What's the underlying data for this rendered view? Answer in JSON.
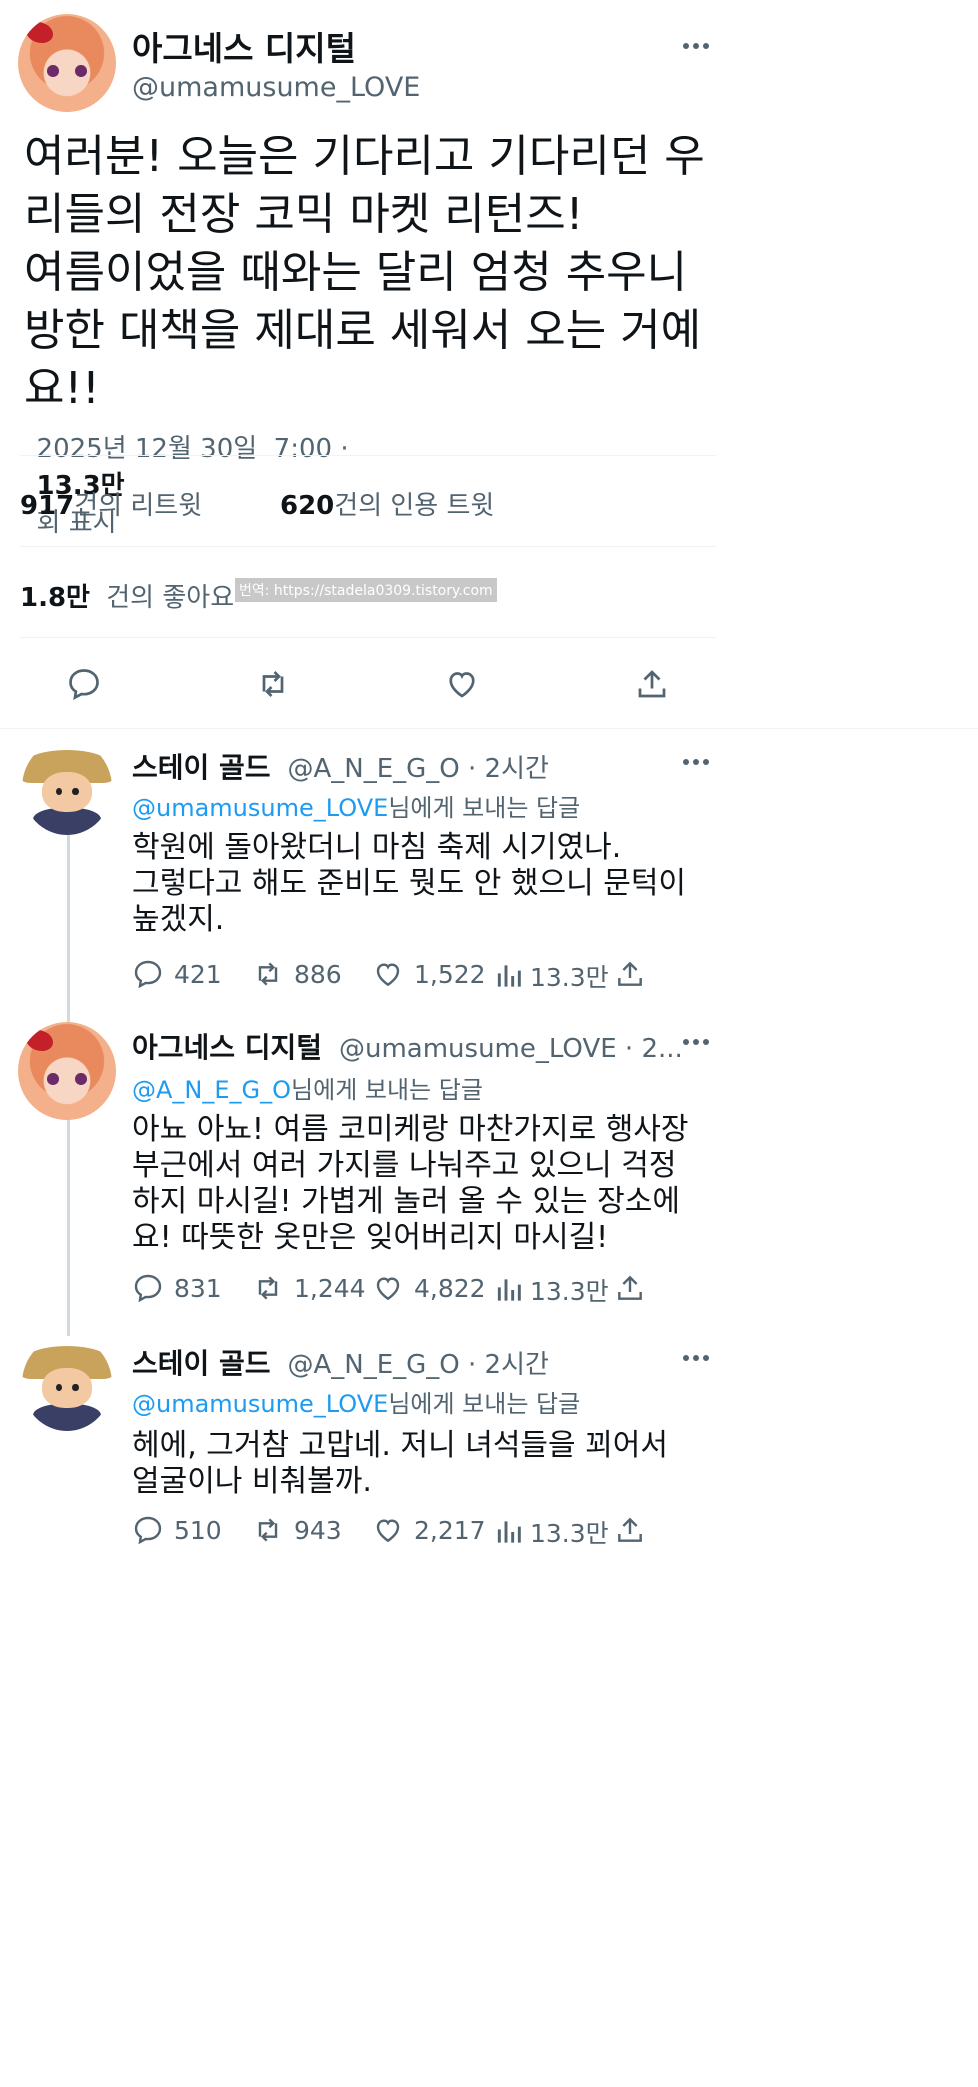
{
  "main_tweet": {
    "author_name": "아그네스 디지털",
    "author_handle": "@umamusume_LOVE",
    "text_lines": [
      "여러분! 오늘은 기다리고 기다리던 우",
      "리들의 전장 코믹 마켓 리턴즈!",
      "여름이었을 때와는 달리 엄청 추우니",
      "방한 대책을 제대로 세워서 오는 거예",
      "요!!"
    ],
    "timestamp": "2025년 12월 30일  7:00 ·",
    "views_count": "13.3만",
    "views_label": "회 표시",
    "retweets_count": "917",
    "retweets_label": "건의 리트윗",
    "quotes_count": "620",
    "quotes_label": "건의 인용 트윗",
    "likes_count": "1.8만",
    "likes_label": "건의 좋아요",
    "watermark": "번역: https://stadela0309.tistory.com"
  },
  "replies": [
    {
      "author_name": "스테이 골드",
      "author_handle": "@A_N_E_G_O · 2시간",
      "reply_to_handle": "@umamusume_LOVE",
      "reply_to_suffix": "님에게 보내는 답글",
      "text_lines": [
        "학원에 돌아왔더니 마침 축제 시기였나.",
        "그렇다고 해도 준비도 뭣도 안 했으니 문턱이",
        "높겠지."
      ],
      "replies": "421",
      "retweets": "886",
      "likes": "1,522",
      "views": "13.3만"
    },
    {
      "author_name": "아그네스 디지털",
      "author_handle": "@umamusume_LOVE · 2...",
      "reply_to_handle": "@A_N_E_G_O",
      "reply_to_suffix": "님에게 보내는 답글",
      "text_lines": [
        "아뇨 아뇨! 여름 코미케랑 마찬가지로 행사장",
        "부근에서 여러 가지를 나눠주고 있으니 걱정",
        "하지 마시길! 가볍게 놀러 올 수 있는 장소에",
        "요! 따뜻한 옷만은 잊어버리지 마시길!"
      ],
      "replies": "831",
      "retweets": "1,244",
      "likes": "4,822",
      "views": "13.3만"
    },
    {
      "author_name": "스테이 골드",
      "author_handle": "@A_N_E_G_O · 2시간",
      "reply_to_handle": "@umamusume_LOVE",
      "reply_to_suffix": "님에게 보내는 답글",
      "text_lines": [
        "헤에, 그거참 고맙네. 저니 녀석들을 꾀어서",
        "얼굴이나 비춰볼까."
      ],
      "replies": "510",
      "retweets": "943",
      "likes": "2,217",
      "views": "13.3만"
    }
  ],
  "colors": {
    "text": "#0f1419",
    "muted": "#536471",
    "link": "#1d9bf0",
    "divider": "#eff3f4"
  },
  "icons": [
    "more-icon",
    "reply-icon",
    "retweet-icon",
    "like-icon",
    "share-icon",
    "views-icon"
  ]
}
